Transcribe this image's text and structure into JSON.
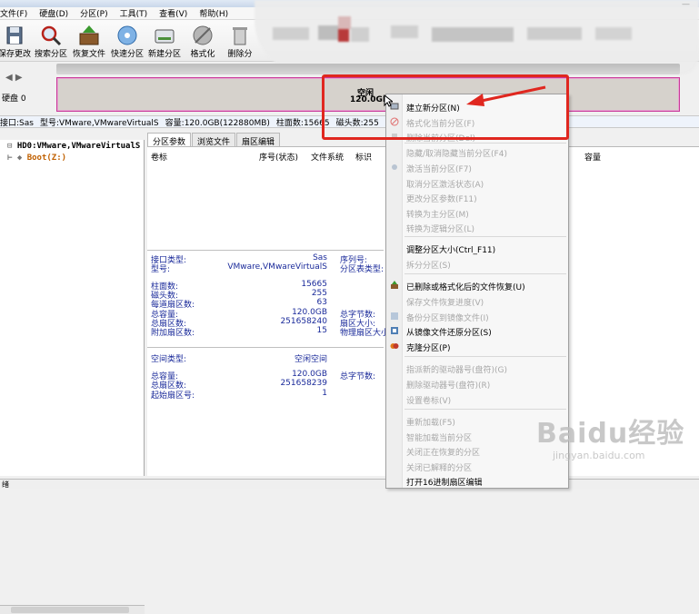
{
  "menubar": {
    "items": [
      "文件(F)",
      "硬盘(D)",
      "分区(P)",
      "工具(T)",
      "查看(V)",
      "帮助(H)"
    ]
  },
  "toolbar": {
    "buttons": [
      {
        "label": "保存更改",
        "icon": "save-icon"
      },
      {
        "label": "搜索分区",
        "icon": "search-icon"
      },
      {
        "label": "恢复文件",
        "icon": "restore-file-icon"
      },
      {
        "label": "快速分区",
        "icon": "quick-partition-icon"
      },
      {
        "label": "新建分区",
        "icon": "new-partition-icon"
      },
      {
        "label": "格式化",
        "icon": "format-icon"
      },
      {
        "label": "删除分",
        "icon": "delete-partition-icon"
      }
    ]
  },
  "disk_map": {
    "disk_label": "硬盘 0",
    "partition_label": "空闲",
    "partition_size": "120.0GB"
  },
  "infobar": {
    "items": [
      "接口:Sas",
      "型号:VMware,VMwareVirtualS",
      "容量:120.0GB(122880MB)",
      "柱面数:15665",
      "磁头数:255",
      "每道"
    ]
  },
  "tree": {
    "disk": "HD0:VMware,VMwareVirtualS",
    "partition": "Boot(Z:)"
  },
  "tabs": [
    "分区参数",
    "浏览文件",
    "扇区编辑"
  ],
  "columns": [
    "卷标",
    "序号(状态)",
    "文件系统",
    "标识",
    "容量"
  ],
  "props": {
    "group1": [
      {
        "label": "接口类型:",
        "value": "Sas",
        "label2": "序列号:"
      },
      {
        "label": "型号:",
        "value": "VMware,VMwareVirtualS",
        "label2": "分区表类型:"
      }
    ],
    "group2": [
      {
        "label": "柱面数:",
        "value": "15665",
        "label2": ""
      },
      {
        "label": "磁头数:",
        "value": "255",
        "label2": ""
      },
      {
        "label": "每道扇区数:",
        "value": "63",
        "label2": ""
      },
      {
        "label": "总容量:",
        "value": "120.0GB",
        "label2": "总字节数:"
      },
      {
        "label": "总扇区数:",
        "value": "251658240",
        "label2": "扇区大小:"
      },
      {
        "label": "附加扇区数:",
        "value": "15",
        "label2": "物理扇区大小:"
      }
    ],
    "group3": [
      {
        "label": "空间类型:",
        "value": "空闲空间",
        "label2": ""
      }
    ],
    "group4": [
      {
        "label": "总容量:",
        "value": "120.0GB",
        "label2": "总字节数:"
      },
      {
        "label": "总扇区数:",
        "value": "251658239",
        "label2": ""
      },
      {
        "label": "起始扇区号:",
        "value": "1",
        "label2": ""
      }
    ]
  },
  "context_menu": {
    "items": [
      {
        "label": "建立新分区(N)",
        "enabled": true
      },
      {
        "label": "格式化当前分区(F)",
        "enabled": false
      },
      {
        "label": "删除当前分区(Del)",
        "enabled": false
      },
      {
        "label": "隐藏/取消隐藏当前分区(F4)",
        "enabled": false
      },
      {
        "label": "激活当前分区(F7)",
        "enabled": false
      },
      {
        "label": "取消分区激活状态(A)",
        "enabled": false
      },
      {
        "label": "更改分区参数(F11)",
        "enabled": false
      },
      {
        "label": "转换为主分区(M)",
        "enabled": false
      },
      {
        "label": "转换为逻辑分区(L)",
        "enabled": false
      },
      {
        "label": "调整分区大小(Ctrl_F11)",
        "enabled": true
      },
      {
        "label": "拆分分区(S)",
        "enabled": false
      },
      {
        "label": "已删除或格式化后的文件恢复(U)",
        "enabled": true
      },
      {
        "label": "保存文件恢复进度(V)",
        "enabled": false
      },
      {
        "label": "备份分区到镜像文件(I)",
        "enabled": false
      },
      {
        "label": "从镜像文件还原分区(S)",
        "enabled": true
      },
      {
        "label": "克隆分区(P)",
        "enabled": true
      },
      {
        "label": "指派新的驱动器号(盘符)(G)",
        "enabled": false
      },
      {
        "label": "删除驱动器号(盘符)(R)",
        "enabled": false
      },
      {
        "label": "设置卷标(V)",
        "enabled": false
      },
      {
        "label": "重新加载(F5)",
        "enabled": false
      },
      {
        "label": "智能加载当前分区",
        "enabled": false
      },
      {
        "label": "关闭正在恢复的分区",
        "enabled": false
      },
      {
        "label": "关闭已解释的分区",
        "enabled": false
      },
      {
        "label": "打开16进制扇区编辑",
        "enabled": true
      }
    ]
  },
  "watermark": {
    "logo": "Baidu经验",
    "url": "jingyan.baidu.com"
  },
  "status": {
    "text": "绪"
  },
  "colors": {
    "highlight_box": "#e0271f",
    "partition_border": "#c93a9a",
    "disabled_text": "#a8a8a8",
    "prop_text": "#1a2a9a"
  }
}
